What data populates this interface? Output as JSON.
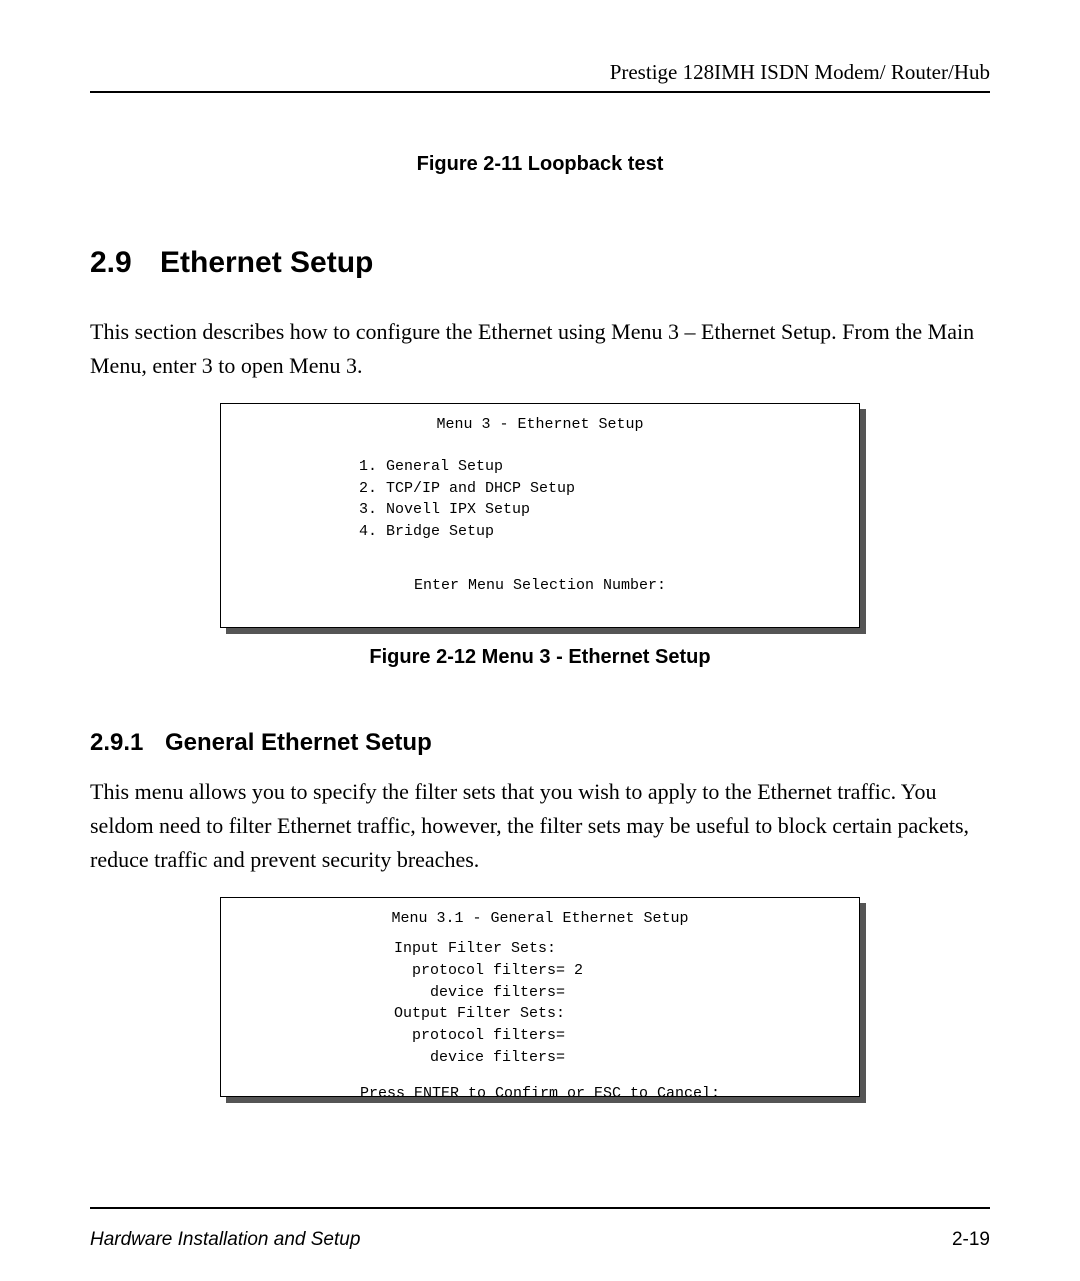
{
  "header": {
    "running": "Prestige 128IMH ISDN Modem/ Router/Hub"
  },
  "fig211": {
    "caption": "Figure 2-11 Loopback test"
  },
  "section29": {
    "num": "2.9",
    "title": "Ethernet Setup",
    "body": "This section describes how to configure the Ethernet using Menu 3 – Ethernet Setup.  From the Main Menu, enter 3 to open Menu 3."
  },
  "menu3": {
    "title": "Menu 3 - Ethernet Setup",
    "items": [
      "1. General Setup",
      "2. TCP/IP and DHCP Setup",
      "3. Novell IPX Setup",
      "4. Bridge Setup"
    ],
    "prompt": "Enter Menu Selection Number:"
  },
  "fig212": {
    "caption": "Figure 2-12 Menu 3 - Ethernet Setup"
  },
  "section291": {
    "num": "2.9.1",
    "title": "General Ethernet Setup",
    "body": "This menu allows you to specify the filter sets that you wish to apply to the Ethernet traffic.  You seldom need to filter Ethernet traffic, however, the filter sets may be useful to block certain packets, reduce traffic and prevent security breaches."
  },
  "menu31": {
    "title": "Menu 3.1 - General Ethernet Setup",
    "lines": "Input Filter Sets:\n  protocol filters= 2\n    device filters=\nOutput Filter Sets:\n  protocol filters=\n    device filters=",
    "prompt": "Press ENTER to Confirm or ESC to Cancel:"
  },
  "footer": {
    "left": "Hardware Installation and Setup",
    "right": "2-19"
  }
}
